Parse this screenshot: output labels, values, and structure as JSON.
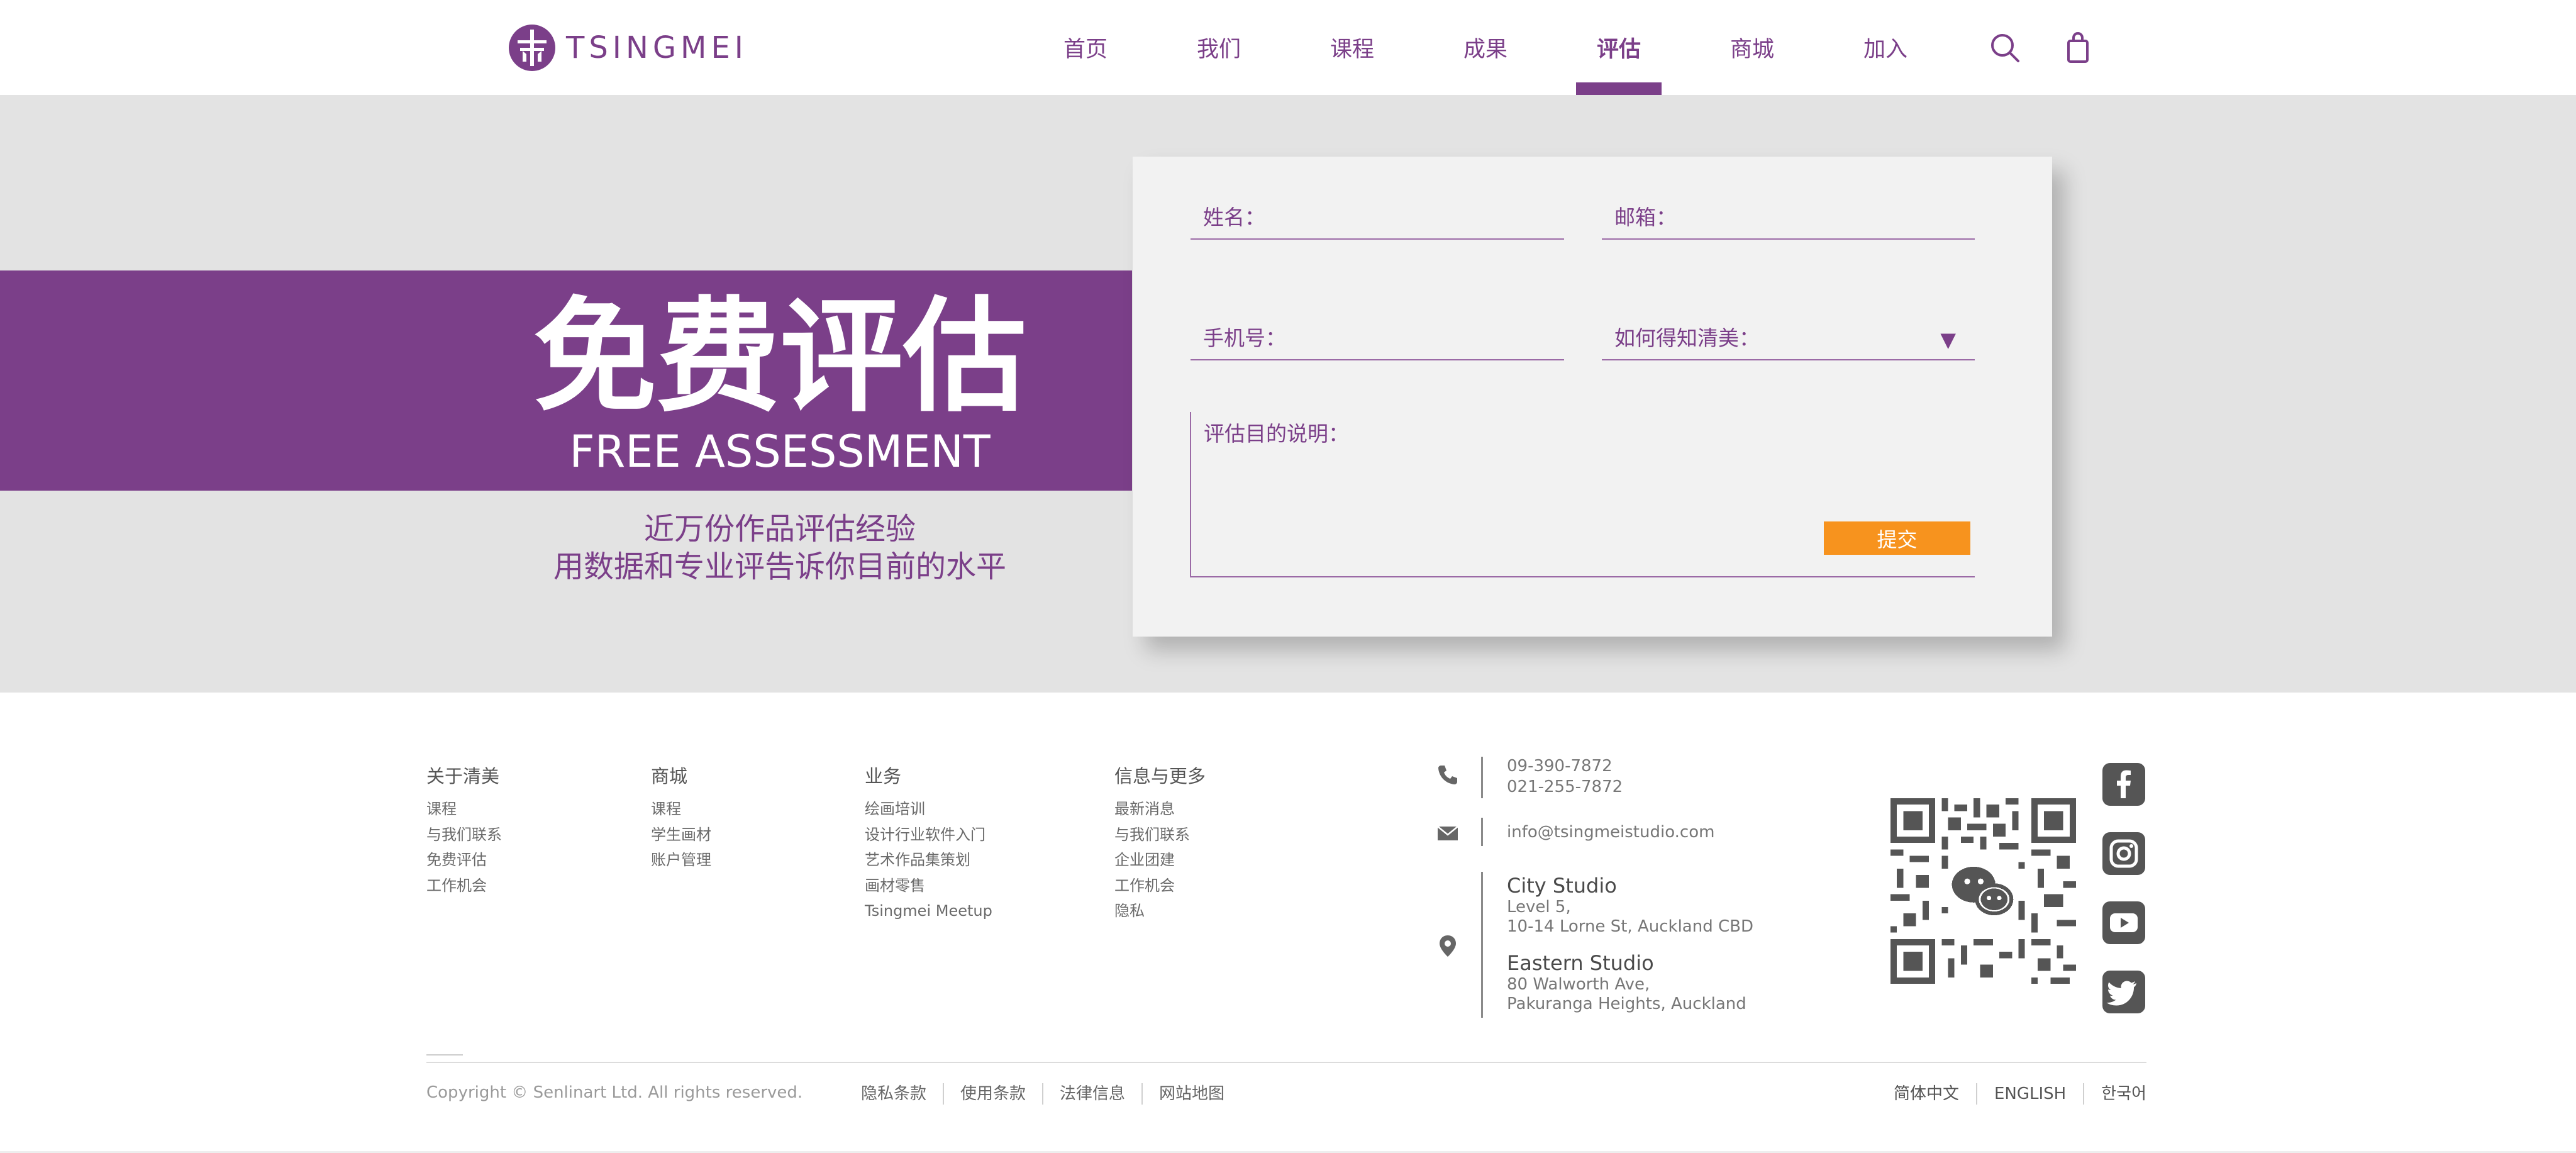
{
  "brand": {
    "name": "TSINGMEI",
    "color": "#7b3f89"
  },
  "nav": {
    "items": [
      {
        "label": "首页",
        "active": false
      },
      {
        "label": "我们",
        "active": false
      },
      {
        "label": "课程",
        "active": false
      },
      {
        "label": "成果",
        "active": false
      },
      {
        "label": "评估",
        "active": true
      },
      {
        "label": "商城",
        "active": false
      },
      {
        "label": "加入",
        "active": false
      }
    ],
    "icons": [
      "search-icon",
      "shopping-bag-icon"
    ]
  },
  "hero": {
    "title": "免费评估",
    "subtitle": "FREE ASSESSMENT",
    "desc_line1": "近万份作品评估经验",
    "desc_line2": "用数据和专业评告诉你目前的水平",
    "background": "#e3e3e3"
  },
  "form": {
    "name_label": "姓名：",
    "email_label": "邮箱：",
    "phone_label": "手机号：",
    "source_label": "如何得知清美：",
    "source_arrow": "▼",
    "purpose_label": "评估目的说明：",
    "submit_label": "提交",
    "submit_color": "#f7931e"
  },
  "footer": {
    "columns": [
      {
        "title": "关于清美",
        "items": [
          "课程",
          "与我们联系",
          "免费评估",
          "工作机会"
        ]
      },
      {
        "title": "商城",
        "items": [
          "课程",
          "学生画材",
          "账户管理"
        ]
      },
      {
        "title": "业务",
        "items": [
          "绘画培训",
          "设计行业软件入门",
          "艺术作品集策划",
          "画材零售",
          "Tsingmei Meetup"
        ]
      },
      {
        "title": "信息与更多",
        "items": [
          "最新消息",
          "与我们联系",
          "企业团建",
          "工作机会",
          "隐私"
        ]
      }
    ],
    "contact": {
      "phone1": "09-390-7872",
      "phone2": "021-255-7872",
      "email": "info@tsingmeistudio.com",
      "studio1_name": "City Studio",
      "studio1_line1": "Level 5,",
      "studio1_line2": "10-14 Lorne St, Auckland CBD",
      "studio2_name": "Eastern Studio",
      "studio2_line1": "80 Walworth Ave,",
      "studio2_line2": "Pakuranga Heights, Auckland"
    },
    "social_icons": [
      "facebook-icon",
      "instagram-icon",
      "youtube-icon",
      "twitter-icon"
    ],
    "copyright": "Copyright © Senlinart Ltd. All rights reserved.",
    "legal": [
      "隐私条款",
      "使用条款",
      "法律信息",
      "网站地图"
    ],
    "languages": [
      "简体中文",
      "ENGLISH",
      "한국어"
    ]
  }
}
